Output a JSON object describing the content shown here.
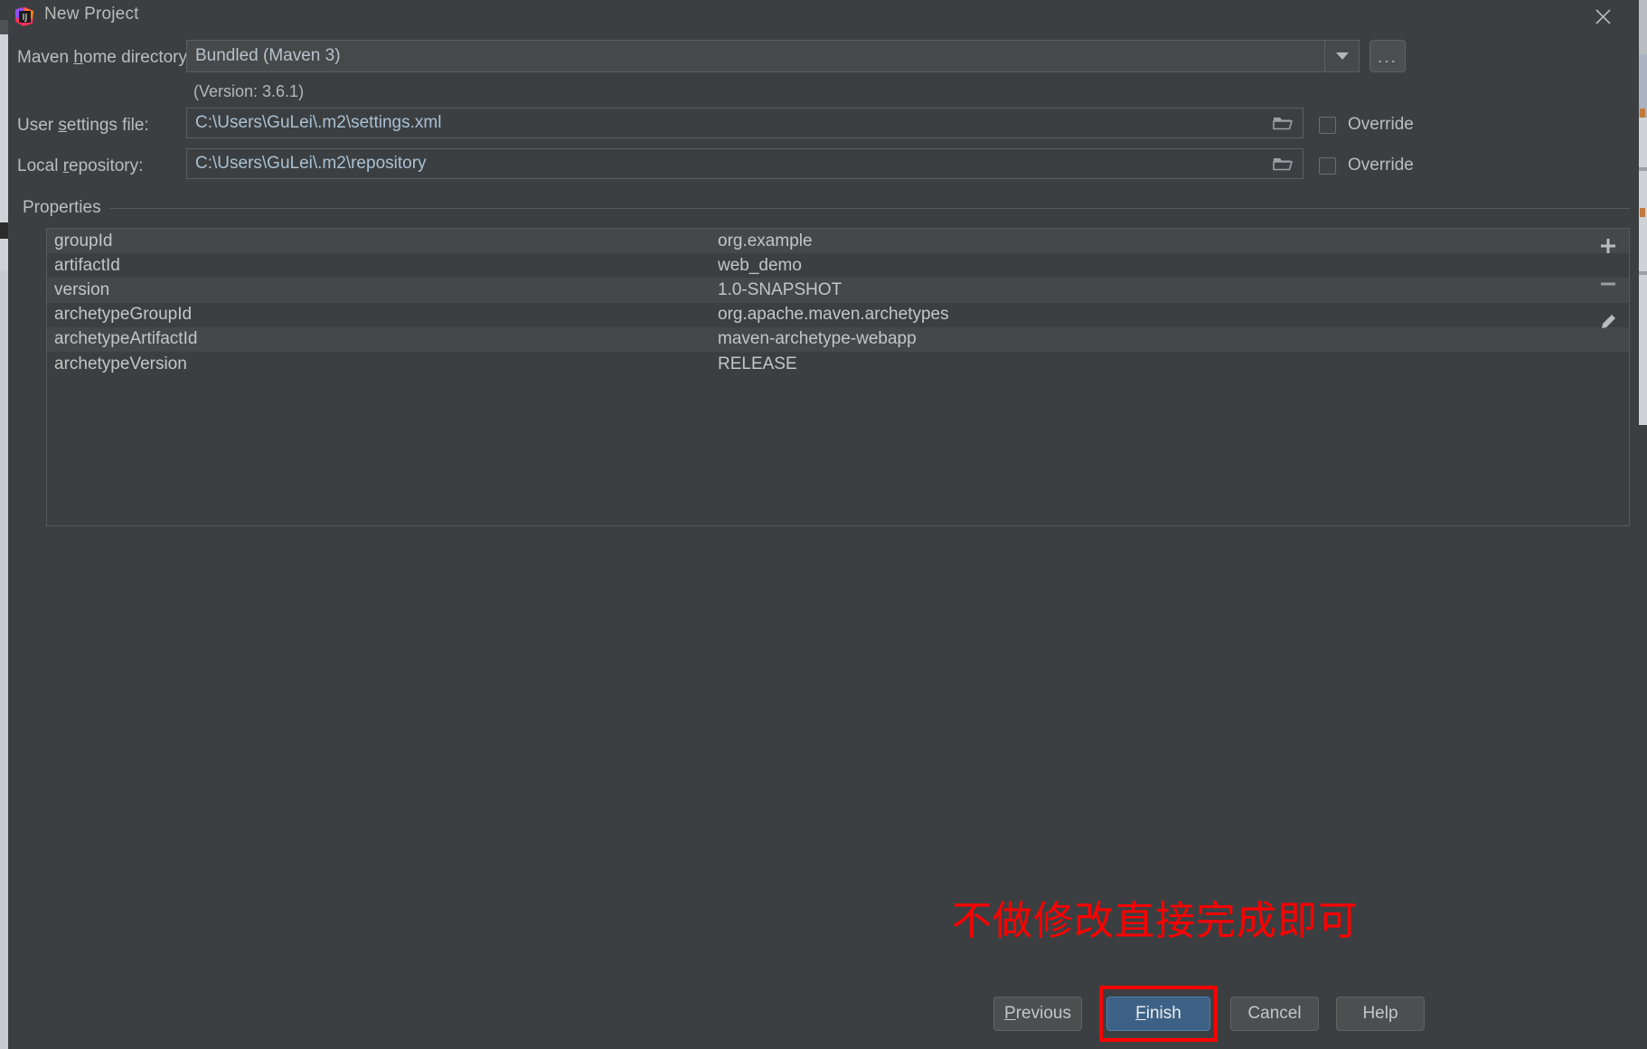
{
  "window": {
    "title": "New Project",
    "icon": "intellij-idea-icon",
    "close_label": "×"
  },
  "form": {
    "maven_home": {
      "label_pre": "Maven ",
      "label_mnemonic": "h",
      "label_post": "ome directory:",
      "value": "Bundled (Maven 3)",
      "version_note": "(Version: 3.6.1)",
      "dropdown_icon": "chevron-down-icon",
      "browse_label": "..."
    },
    "user_settings": {
      "label_pre": "User ",
      "label_mnemonic": "s",
      "label_post": "ettings file:",
      "value": "C:\\Users\\GuLei\\.m2\\settings.xml",
      "folder_icon": "folder-open-icon",
      "override_label": "Override",
      "override_checked": false
    },
    "local_repository": {
      "label_pre": "Local ",
      "label_mnemonic": "r",
      "label_post": "epository:",
      "value": "C:\\Users\\GuLei\\.m2\\repository",
      "folder_icon": "folder-open-icon",
      "override_label": "Override",
      "override_checked": false
    }
  },
  "properties": {
    "group_title": "Properties",
    "rows": [
      {
        "key": "groupId",
        "value": "org.example"
      },
      {
        "key": "artifactId",
        "value": "web_demo"
      },
      {
        "key": "version",
        "value": "1.0-SNAPSHOT"
      },
      {
        "key": "archetypeGroupId",
        "value": "org.apache.maven.archetypes"
      },
      {
        "key": "archetypeArtifactId",
        "value": "maven-archetype-webapp"
      },
      {
        "key": "archetypeVersion",
        "value": "RELEASE"
      }
    ],
    "toolbar": {
      "add_icon": "plus-icon",
      "remove_icon": "minus-icon",
      "edit_icon": "pencil-icon"
    }
  },
  "annotation": {
    "text": "不做修改直接完成即可",
    "color": "#ff0000",
    "highlight_target": "finish-button"
  },
  "footer": {
    "previous": {
      "pre": "",
      "mnemonic": "P",
      "post": "revious"
    },
    "finish": {
      "pre": "",
      "mnemonic": "F",
      "post": "inish"
    },
    "cancel": {
      "pre": "Cancel",
      "mnemonic": "",
      "post": ""
    },
    "help": {
      "pre": "Help",
      "mnemonic": "",
      "post": ""
    }
  },
  "colors": {
    "dialog_bg": "#3c3f41",
    "field_bg": "#45494a",
    "accent": "#3d6185",
    "annotation": "#ff0000",
    "path_text": "#a9c1d4"
  }
}
